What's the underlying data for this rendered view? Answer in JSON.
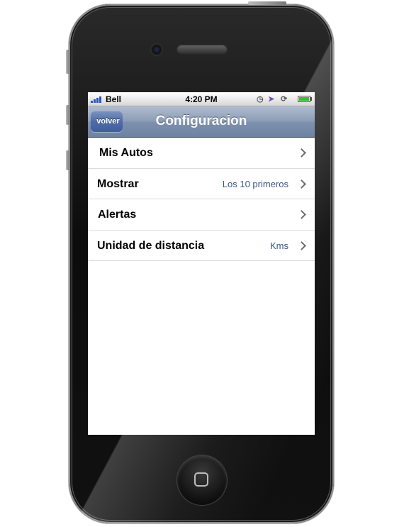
{
  "status_bar": {
    "carrier": "Bell",
    "time": "4:20 PM",
    "icons": [
      "signal-icon",
      "clock-icon",
      "location-arrow-icon",
      "rotation-lock-icon",
      "battery-icon"
    ],
    "battery_color": "#33c233"
  },
  "nav": {
    "back_label": "volver",
    "title": "Configuracion"
  },
  "settings": [
    {
      "label": "Mis Autos",
      "value": ""
    },
    {
      "label": "Mostrar",
      "value": "Los 10 primeros"
    },
    {
      "label": "Alertas",
      "value": ""
    },
    {
      "label": "Unidad de distancia",
      "value": "Kms"
    }
  ],
  "colors": {
    "navbar": "#8c9db7",
    "back_button": "#4f6da8",
    "detail_text": "#3a5686"
  }
}
